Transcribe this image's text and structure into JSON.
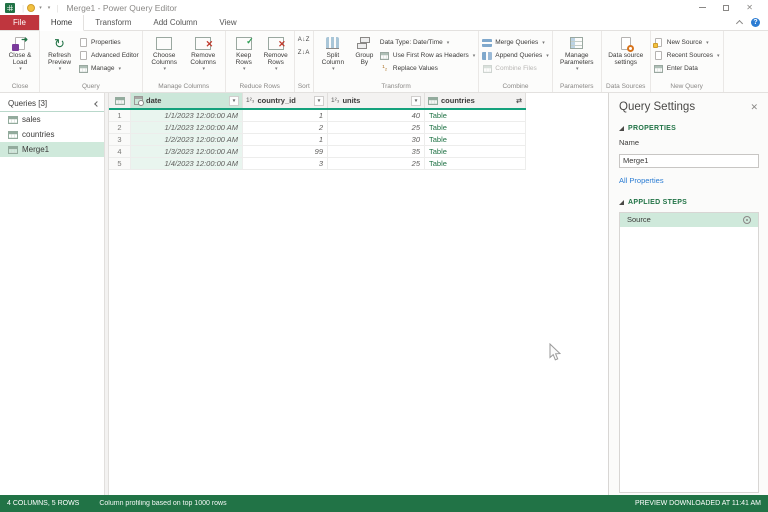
{
  "glyphs": {
    "caret": "▾",
    "sort_az": "A↓Z",
    "sort_za": "Z↓A",
    "expand": "⇄",
    "number_type": "1²₃",
    "replace_icon": "¹₂",
    "close_x": "✕",
    "question": "?",
    "arrow": "➜"
  },
  "titlebar": {
    "title": "Merge1 - Power Query Editor"
  },
  "tab_bar": {
    "file": "File",
    "tabs": [
      "Home",
      "Transform",
      "Add Column",
      "View"
    ],
    "active_tab": "Home"
  },
  "ribbon": {
    "close_group": {
      "label": "Close",
      "close_load": "Close & Load"
    },
    "query_group": {
      "label": "Query",
      "refresh": "Refresh Preview",
      "properties": "Properties",
      "advanced_editor": "Advanced Editor",
      "manage": "Manage"
    },
    "manage_columns_group": {
      "label": "Manage Columns",
      "choose": "Choose Columns",
      "remove": "Remove Columns"
    },
    "reduce_rows_group": {
      "label": "Reduce Rows",
      "keep": "Keep Rows",
      "remove": "Remove Rows"
    },
    "sort_group": {
      "label": "Sort"
    },
    "transform_group": {
      "label": "Transform",
      "split": "Split Column",
      "group_by": "Group By",
      "data_type": "Data Type: Date/Time",
      "first_row": "Use First Row as Headers",
      "replace": "Replace Values"
    },
    "combine_group": {
      "label": "Combine",
      "merge": "Merge Queries",
      "append": "Append Queries",
      "combine_files": "Combine Files"
    },
    "parameters_group": {
      "label": "Parameters",
      "manage_parameters": "Manage Parameters"
    },
    "data_sources_group": {
      "label": "Data Sources",
      "settings": "Data source settings"
    },
    "new_query_group": {
      "label": "New Query",
      "new_source": "New Source",
      "recent_sources": "Recent Sources",
      "enter_data": "Enter Data"
    }
  },
  "queries_panel": {
    "header": "Queries [3]",
    "items": [
      {
        "name": "sales"
      },
      {
        "name": "countries"
      },
      {
        "name": "Merge1"
      }
    ],
    "selected": "Merge1"
  },
  "data_table": {
    "columns": {
      "date": {
        "label": "date",
        "type": "datetime"
      },
      "country_id": {
        "label": "country_id",
        "type": "whole-number"
      },
      "units": {
        "label": "units",
        "type": "whole-number"
      },
      "countries": {
        "label": "countries",
        "type": "table"
      }
    },
    "selected_column": "date",
    "rows": [
      {
        "num": "1",
        "date": "1/1/2023 12:00:00 AM",
        "country_id": "1",
        "units": "40",
        "countries": "Table"
      },
      {
        "num": "2",
        "date": "1/1/2023 12:00:00 AM",
        "country_id": "2",
        "units": "25",
        "countries": "Table"
      },
      {
        "num": "3",
        "date": "1/2/2023 12:00:00 AM",
        "country_id": "1",
        "units": "30",
        "countries": "Table"
      },
      {
        "num": "4",
        "date": "1/3/2023 12:00:00 AM",
        "country_id": "99",
        "units": "35",
        "countries": "Table"
      },
      {
        "num": "5",
        "date": "1/4/2023 12:00:00 AM",
        "country_id": "3",
        "units": "25",
        "countries": "Table"
      }
    ]
  },
  "query_settings": {
    "title": "Query Settings",
    "properties_label": "PROPERTIES",
    "name_label": "Name",
    "name_value": "Merge1",
    "all_properties_label": "All Properties",
    "applied_steps_label": "APPLIED STEPS",
    "steps": [
      {
        "name": "Source"
      }
    ],
    "selected_step": "Source"
  },
  "status_bar": {
    "columns_rows": "4 COLUMNS, 5 ROWS",
    "profiling": "Column profiling based on top 1000 rows",
    "preview_status": "PREVIEW DOWNLOADED AT 11:41 AM"
  },
  "colors": {
    "accent_green": "#217346",
    "file_tab_red": "#bf363e",
    "selection_green": "#cfe9db",
    "header_teal": "#14a17c",
    "link_blue": "#2b7cd3"
  }
}
